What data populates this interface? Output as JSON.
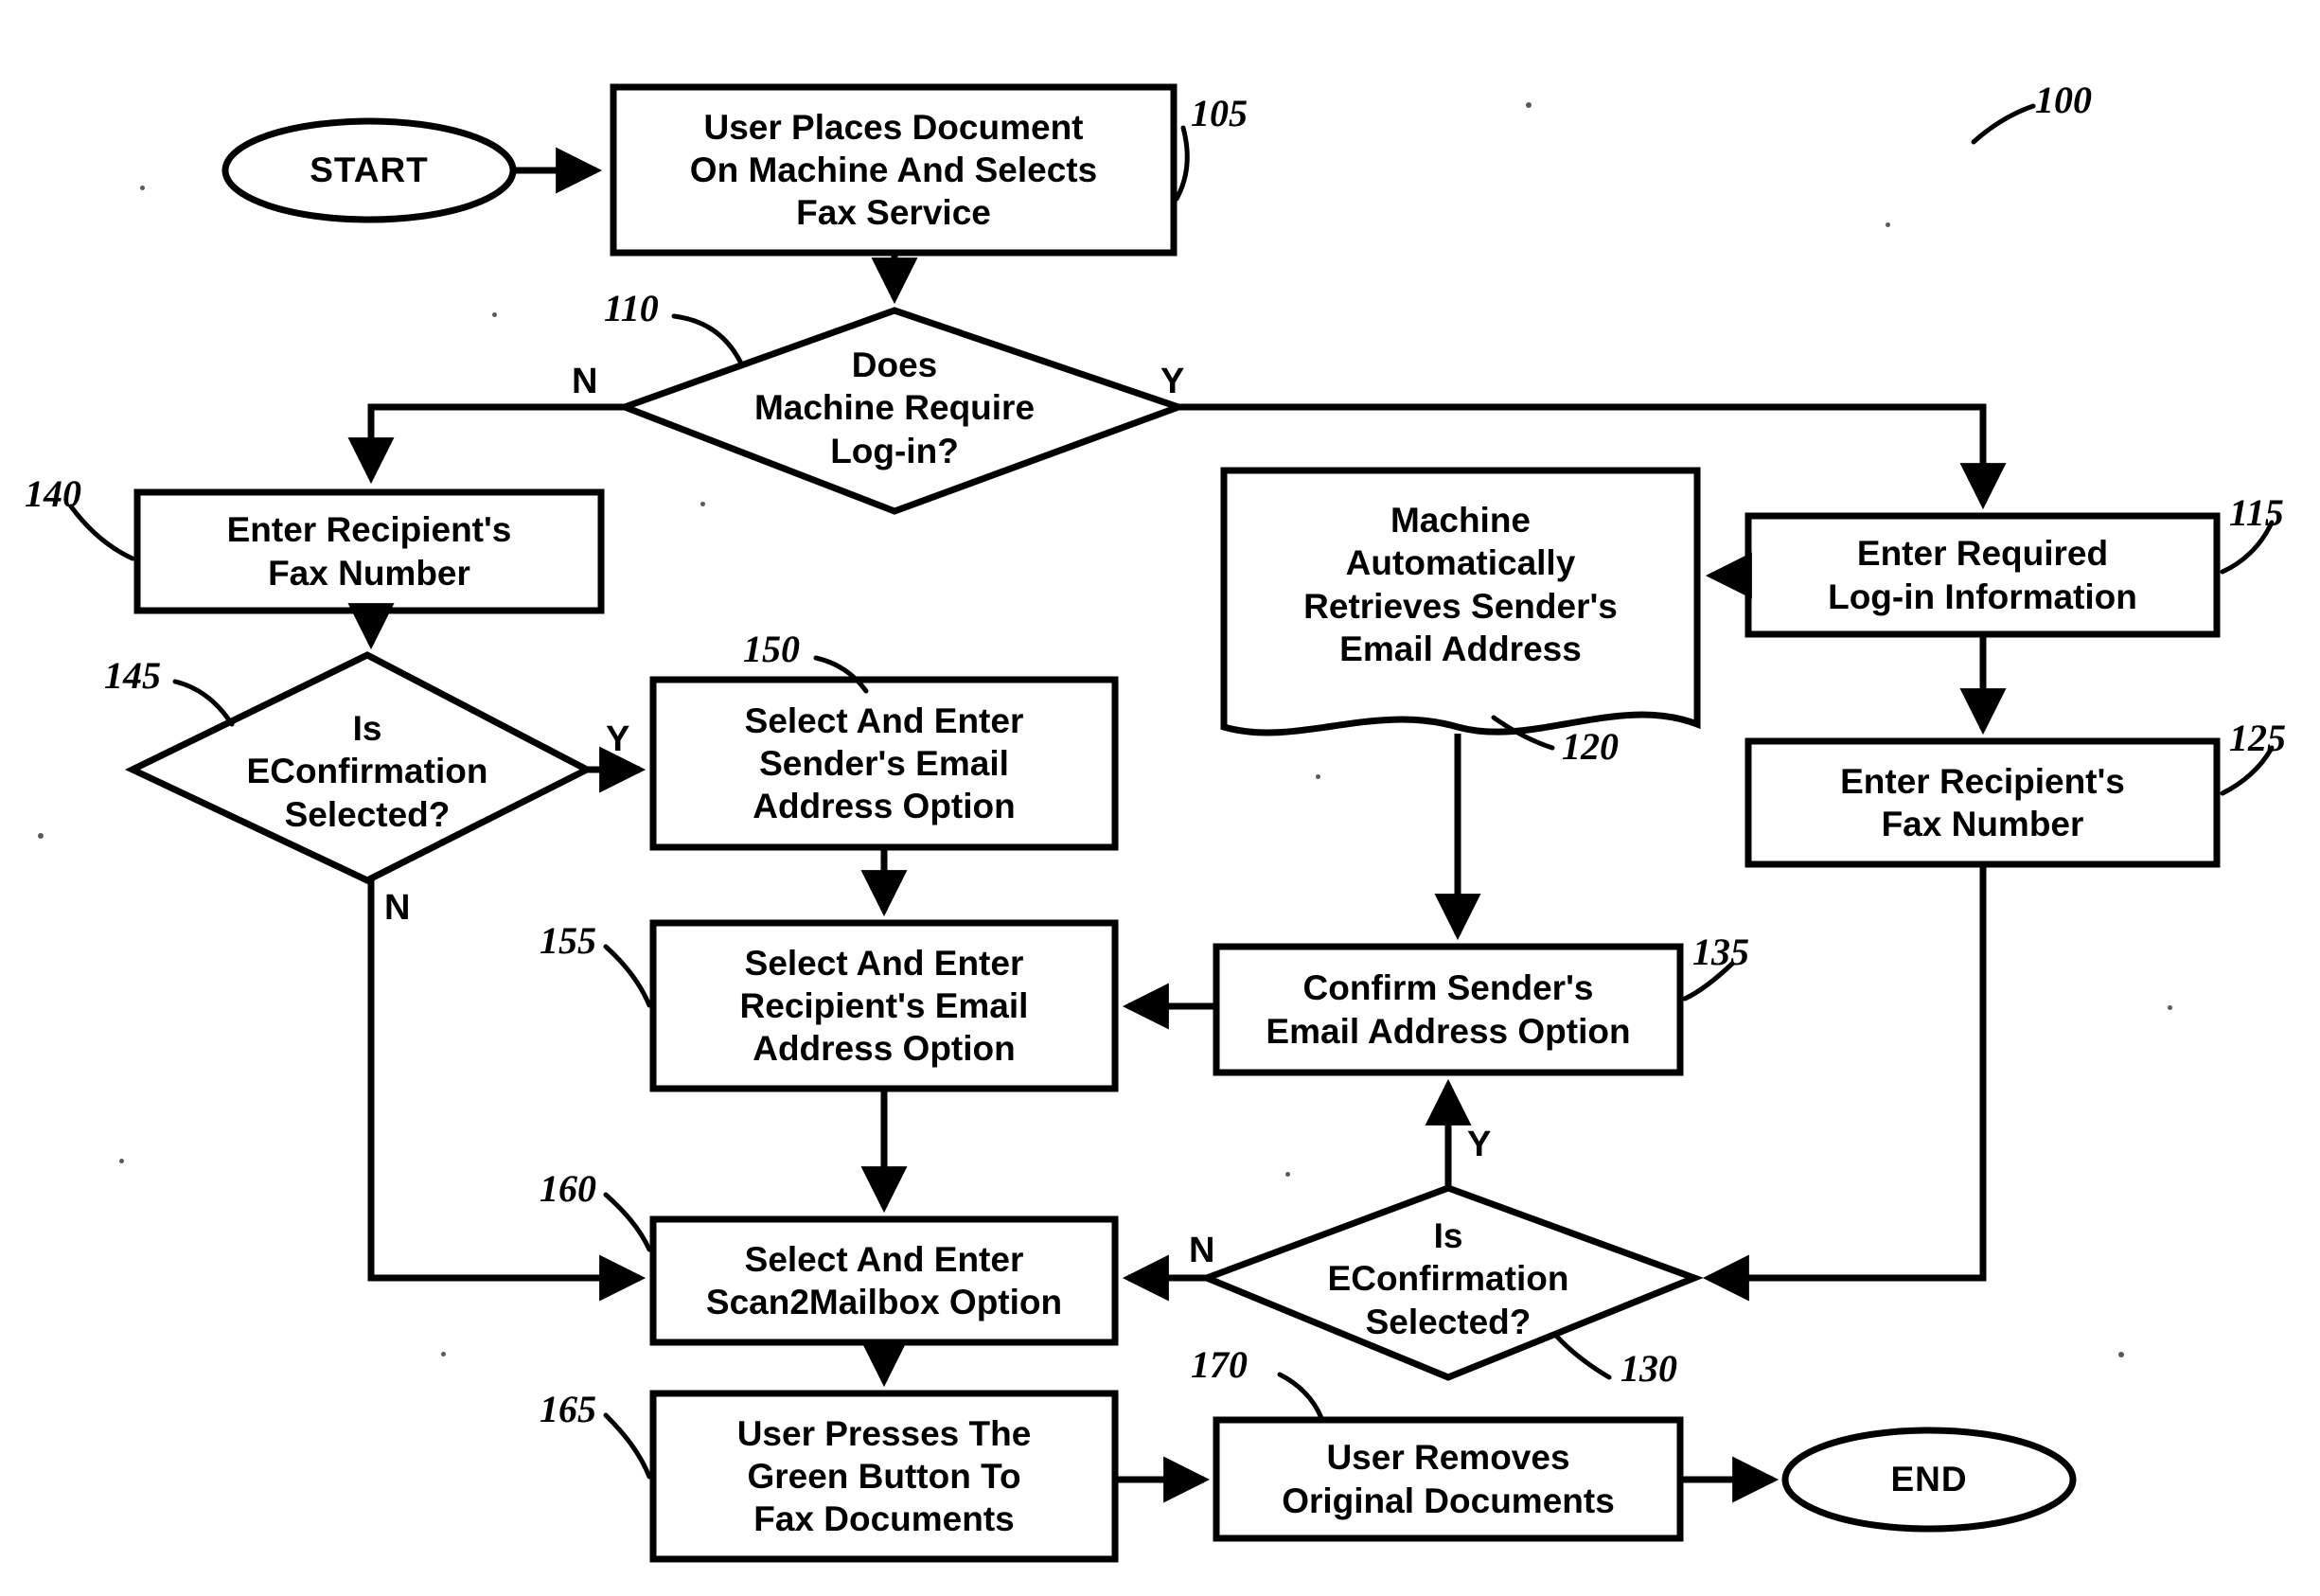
{
  "figure": {
    "label": "100",
    "type": "flowchart"
  },
  "terminators": [
    {
      "id": "start",
      "label": "START"
    },
    {
      "id": "end",
      "label": "END"
    }
  ],
  "nodes": [
    {
      "id": "n105",
      "ref": "105",
      "shape": "process",
      "text": "User Places Document\nOn Machine And Selects\nFax Service"
    },
    {
      "id": "n110",
      "ref": "110",
      "shape": "decision",
      "text": "Does\nMachine Require\nLog-in?"
    },
    {
      "id": "n115",
      "ref": "115",
      "shape": "process",
      "text": "Enter Required\nLog-in Information"
    },
    {
      "id": "n120",
      "ref": "120",
      "shape": "document",
      "text": "Machine\nAutomatically\nRetrieves Sender's\nEmail Address"
    },
    {
      "id": "n125",
      "ref": "125",
      "shape": "process",
      "text": "Enter Recipient's\nFax Number"
    },
    {
      "id": "n130",
      "ref": "130",
      "shape": "decision",
      "text": "Is\nEConfirmation\nSelected?"
    },
    {
      "id": "n135",
      "ref": "135",
      "shape": "process",
      "text": "Confirm Sender's\nEmail Address Option"
    },
    {
      "id": "n140",
      "ref": "140",
      "shape": "process",
      "text": "Enter Recipient's\nFax Number"
    },
    {
      "id": "n145",
      "ref": "145",
      "shape": "decision",
      "text": "Is\nEConfirmation\nSelected?"
    },
    {
      "id": "n150",
      "ref": "150",
      "shape": "process",
      "text": "Select And Enter\nSender's Email\nAddress Option"
    },
    {
      "id": "n155",
      "ref": "155",
      "shape": "process",
      "text": "Select And Enter\nRecipient's Email\nAddress Option"
    },
    {
      "id": "n160",
      "ref": "160",
      "shape": "process",
      "text": "Select And Enter\nScan2Mailbox Option"
    },
    {
      "id": "n165",
      "ref": "165",
      "shape": "process",
      "text": "User Presses The\nGreen Button To\nFax Documents"
    },
    {
      "id": "n170",
      "ref": "170",
      "shape": "process",
      "text": "User Removes\nOriginal Documents"
    }
  ],
  "edge_labels": {
    "d110_no": "N",
    "d110_yes": "Y",
    "d145_yes": "Y",
    "d145_no": "N",
    "d130_no": "N",
    "d130_yes": "Y"
  },
  "colors": {
    "stroke": "#000000",
    "background": "#ffffff"
  }
}
